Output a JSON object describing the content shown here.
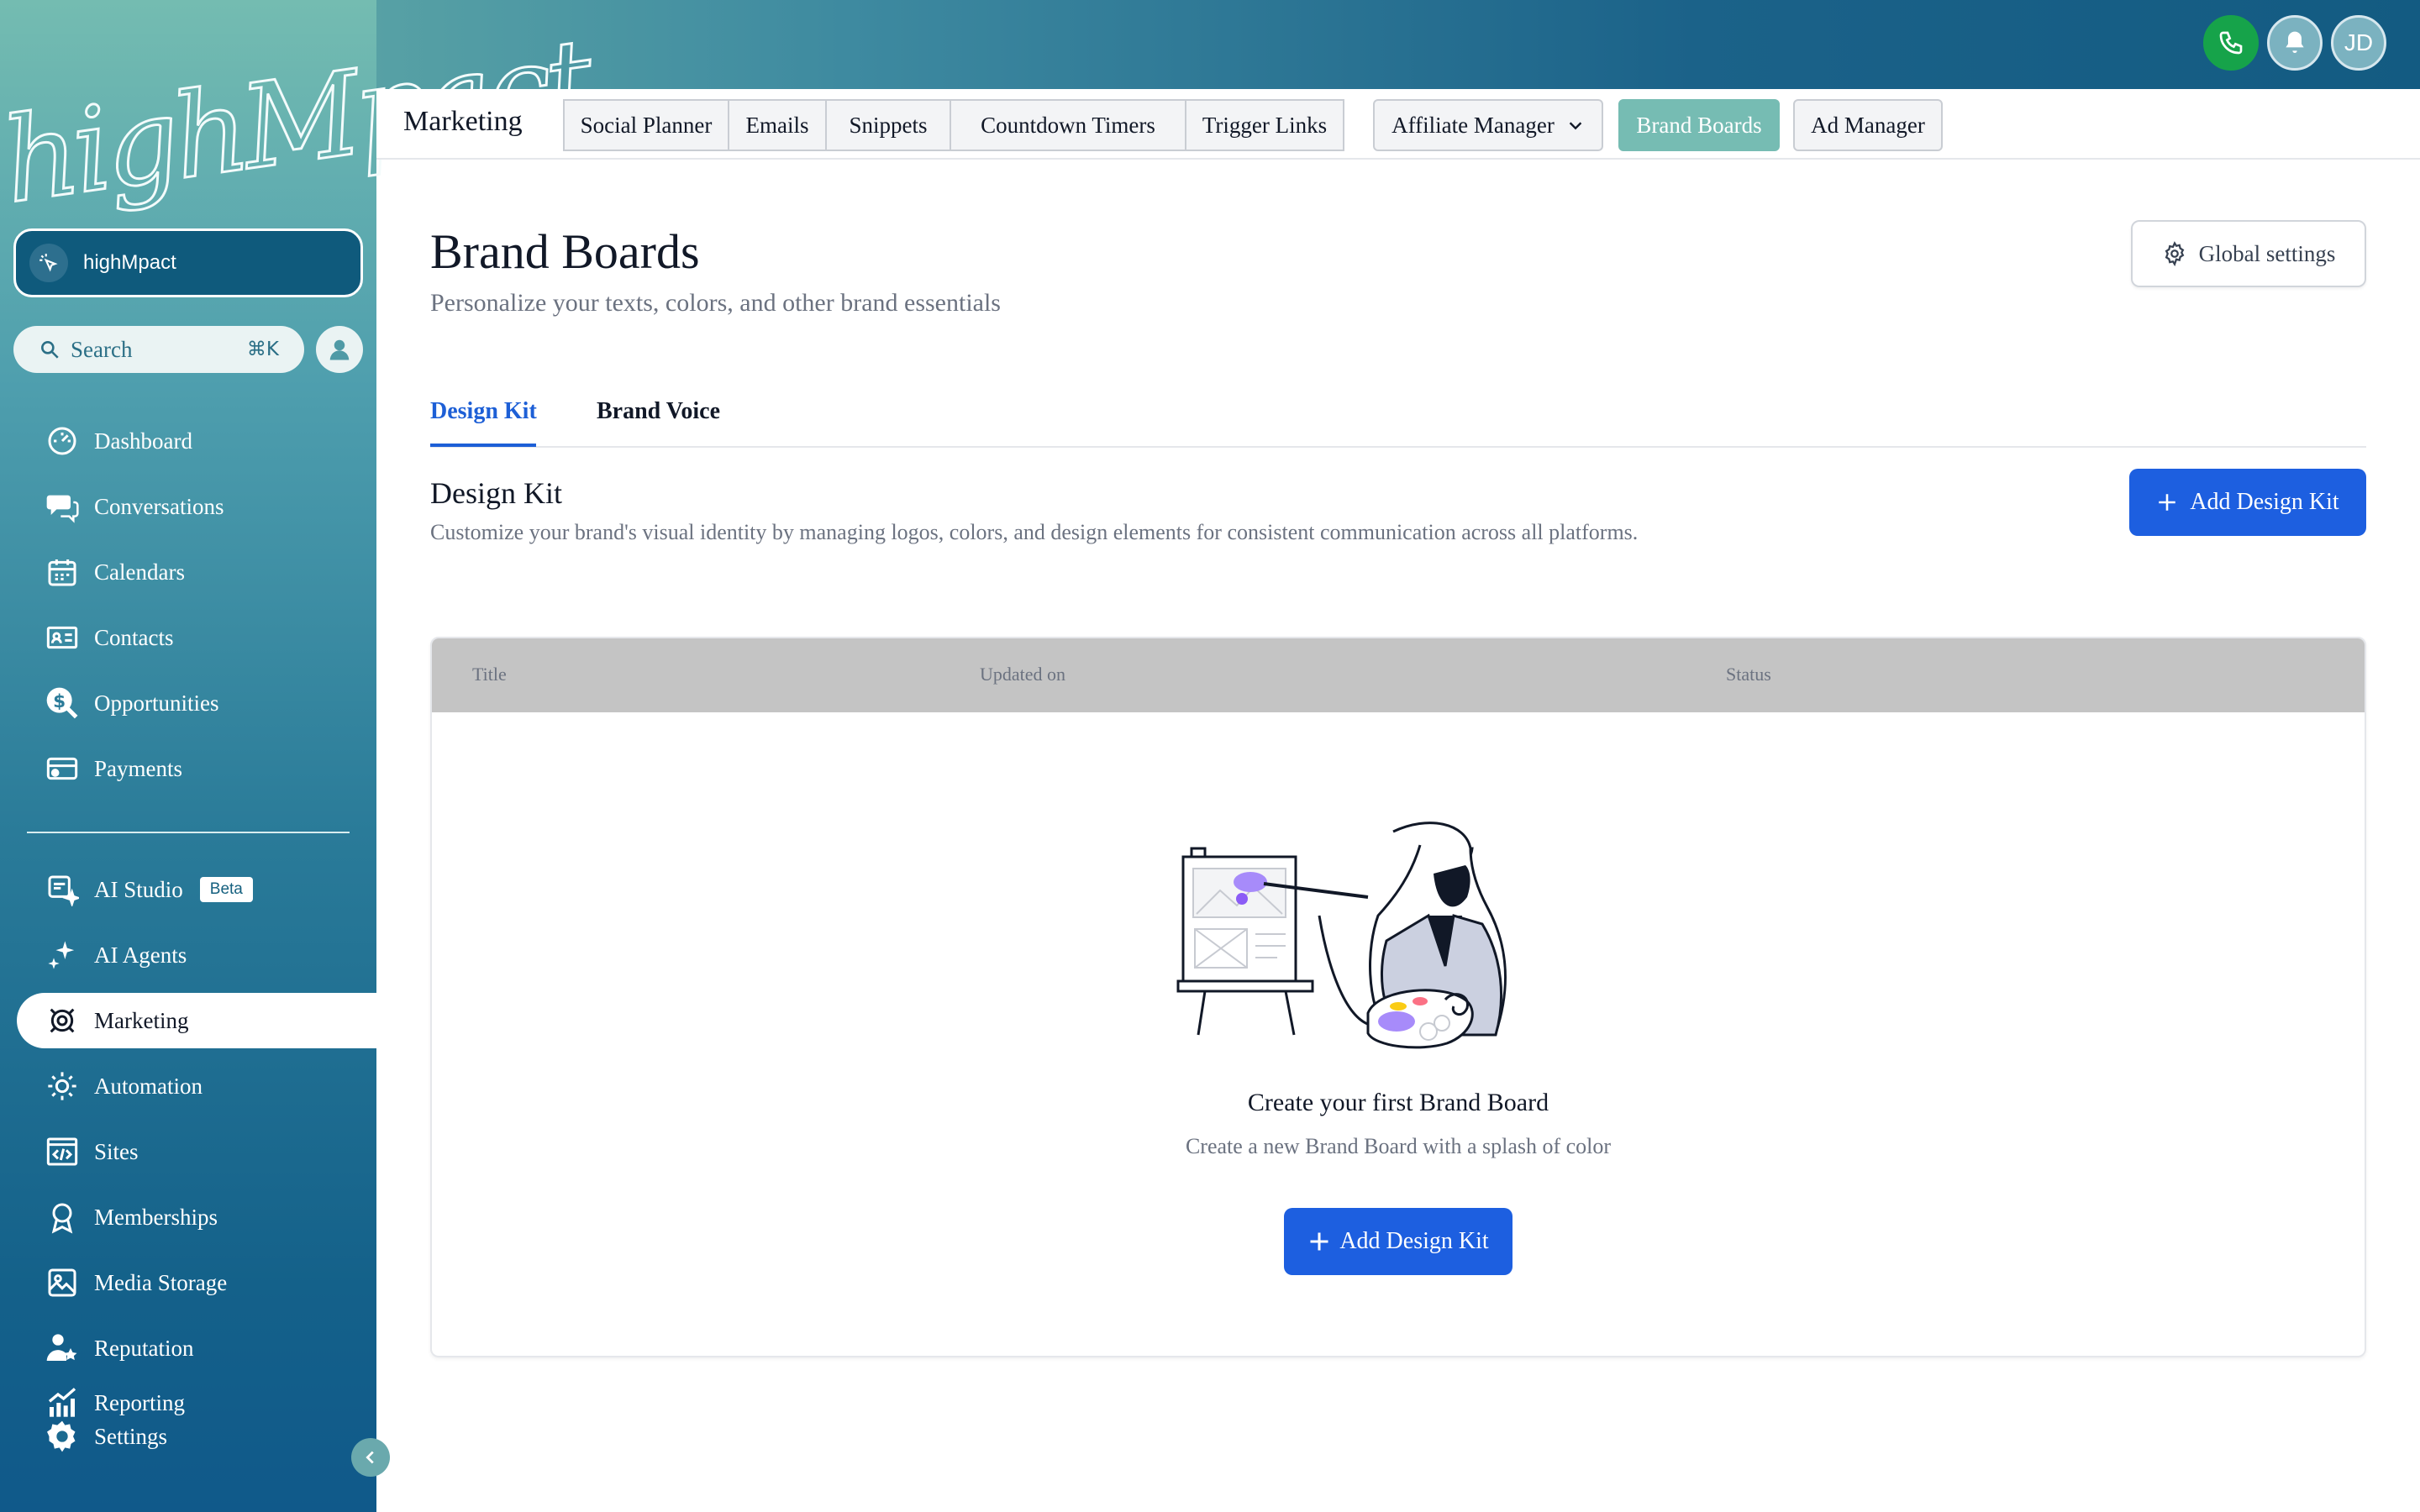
{
  "app": {
    "logo_text": "highMpact",
    "account_name": "highMpact",
    "user_initials": "JD"
  },
  "search": {
    "label": "Search",
    "shortcut": "⌘K"
  },
  "sidebar": {
    "items": [
      {
        "label": "Dashboard",
        "icon": "dashboard-icon"
      },
      {
        "label": "Conversations",
        "icon": "chat-icon"
      },
      {
        "label": "Calendars",
        "icon": "calendar-icon"
      },
      {
        "label": "Contacts",
        "icon": "contacts-icon"
      },
      {
        "label": "Opportunities",
        "icon": "dollar-icon"
      },
      {
        "label": "Payments",
        "icon": "payments-icon"
      },
      {
        "label": "AI Studio",
        "icon": "ai-studio-icon",
        "badge": "Beta"
      },
      {
        "label": "AI Agents",
        "icon": "sparkle-icon"
      },
      {
        "label": "Marketing",
        "icon": "marketing-icon",
        "active": true
      },
      {
        "label": "Automation",
        "icon": "automation-icon"
      },
      {
        "label": "Sites",
        "icon": "sites-icon"
      },
      {
        "label": "Memberships",
        "icon": "memberships-icon"
      },
      {
        "label": "Media Storage",
        "icon": "image-icon"
      },
      {
        "label": "Reputation",
        "icon": "reputation-icon"
      },
      {
        "label": "Reporting",
        "icon": "reporting-icon"
      },
      {
        "label": "Settings",
        "icon": "settings-icon"
      }
    ]
  },
  "topnav": {
    "section": "Marketing",
    "tabs": [
      {
        "label": "Social Planner"
      },
      {
        "label": "Emails"
      },
      {
        "label": "Snippets"
      },
      {
        "label": "Countdown Timers"
      },
      {
        "label": "Trigger Links"
      },
      {
        "label": "Affiliate Manager"
      },
      {
        "label": "Brand Boards",
        "active": true
      },
      {
        "label": "Ad Manager"
      }
    ]
  },
  "page": {
    "title": "Brand Boards",
    "subtitle": "Personalize your texts, colors, and other brand essentials",
    "global_settings": "Global settings",
    "subtabs": [
      {
        "label": "Design Kit",
        "active": true
      },
      {
        "label": "Brand Voice"
      }
    ],
    "section_title": "Design Kit",
    "section_desc": "Customize your brand's visual identity by managing logos, colors, and design elements for consistent communication across all platforms.",
    "add_button": "Add Design Kit"
  },
  "table": {
    "columns": [
      "Title",
      "Updated on",
      "Status"
    ],
    "empty_title": "Create your first Brand Board",
    "empty_sub": "Create a new Brand Board with a splash of color",
    "empty_button": "Add Design Kit"
  },
  "colors": {
    "primary": "#1d5fe0",
    "active_tab": "#76bcb3",
    "sidebar_top": "#74bcb1",
    "sidebar_bottom": "#10598a"
  }
}
